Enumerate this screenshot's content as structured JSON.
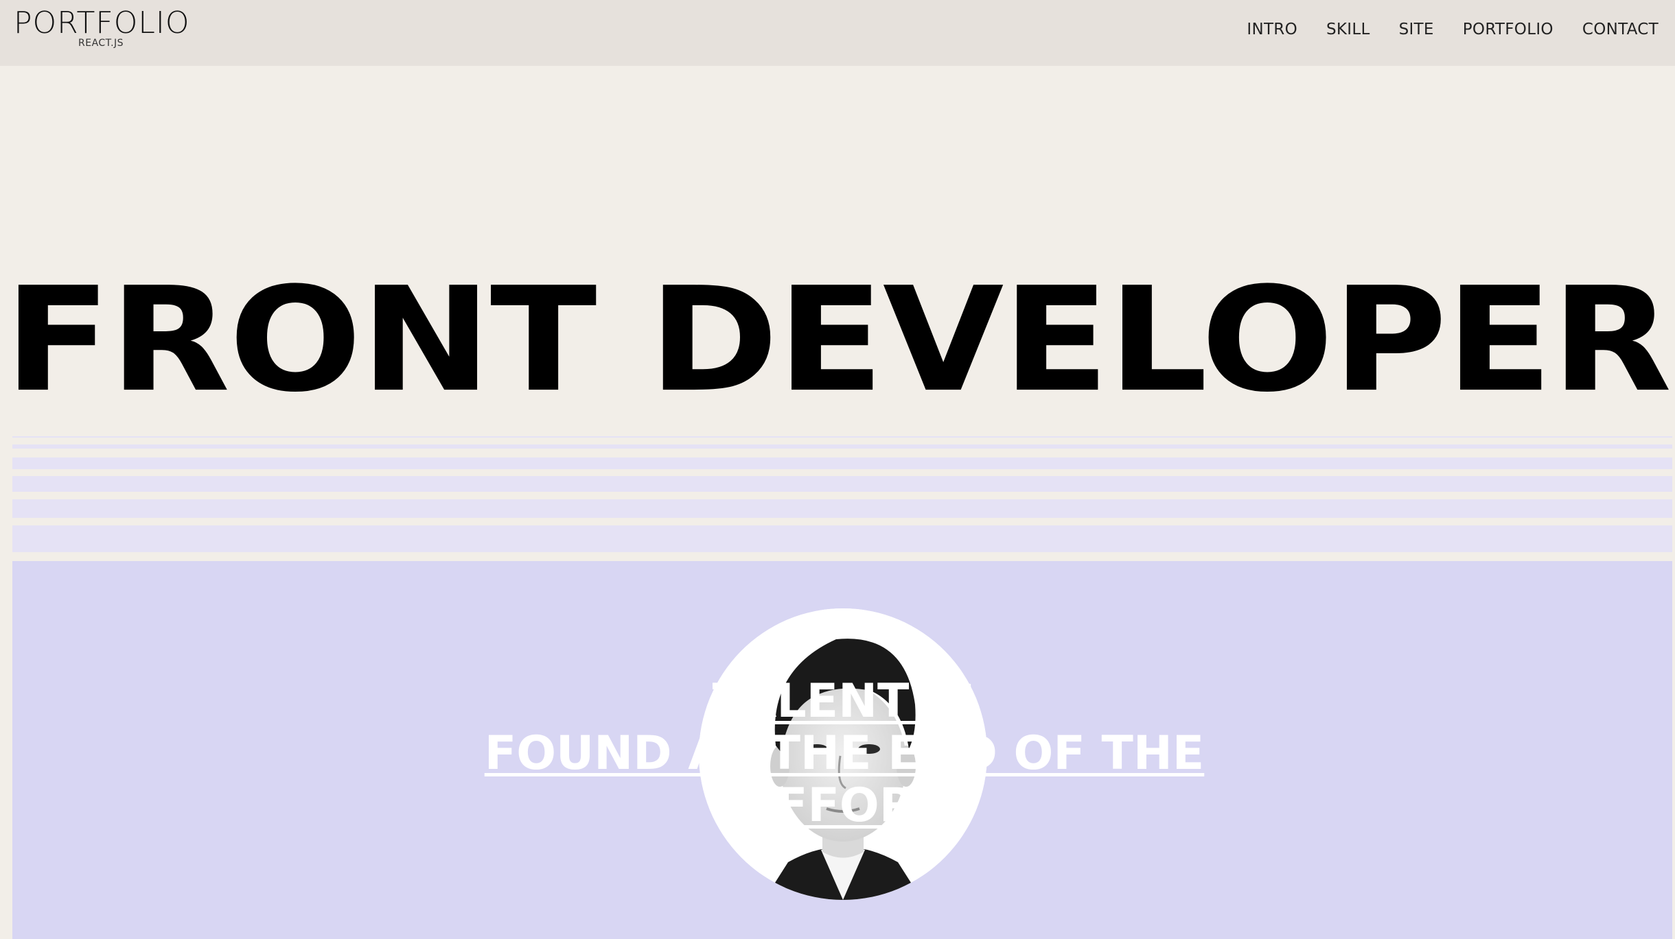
{
  "header": {
    "logo_title": "PORTFOLIO",
    "logo_sub": "REACT.JS",
    "nav": [
      {
        "label": "INTRO"
      },
      {
        "label": "SKILL"
      },
      {
        "label": "SITE"
      },
      {
        "label": "PORTFOLIO"
      },
      {
        "label": "CONTACT"
      }
    ]
  },
  "hero": {
    "title": "FRONT DEVELOPER"
  },
  "intro": {
    "line1": "TALENT IS",
    "line2": "FOUND AT THE END OF THE",
    "line3": "EFFORT"
  },
  "colors": {
    "header_bg": "#e6e1dc",
    "page_bg": "#f2eee8",
    "stripe": "#e5e2f5",
    "section_bg": "#d8d6f3"
  }
}
